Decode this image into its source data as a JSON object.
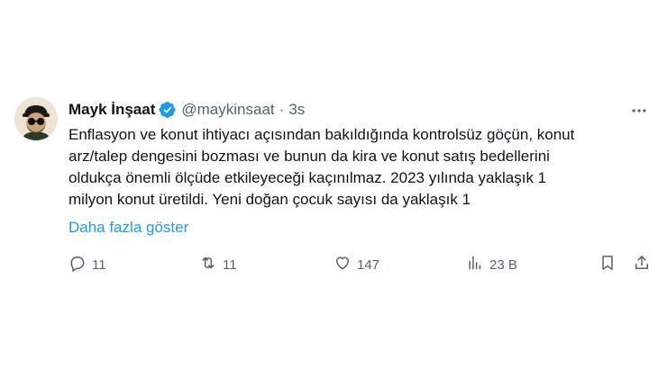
{
  "tweet": {
    "display_name": "Mayk İnşaat",
    "handle": "@maykinsaat",
    "separator": "·",
    "time": "3s",
    "text_lines": [
      "Enflasyon ve konut ihtiyacı açısından bakıldığında kontrolsüz göçün, konut",
      "arz/talep dengesini bozması ve bunun da kira ve konut satış bedellerini",
      "oldukça önemli ölçüde etkileyeceği kaçınılmaz. 2023 yılında yaklaşık 1",
      "milyon konut üretildi. Yeni doğan çocuk sayısı da yaklaşık 1"
    ],
    "show_more": "Daha fazla göster"
  },
  "actions": {
    "reply_count": "11",
    "retweet_count": "11",
    "like_count": "147",
    "views_count": "23 B"
  },
  "colors": {
    "accent": "#1d9bf0",
    "secondary_text": "#536471",
    "primary_text": "#0f1419"
  },
  "icons": [
    "verified-badge-icon",
    "more-icon",
    "reply-icon",
    "retweet-icon",
    "like-icon",
    "views-icon",
    "bookmark-icon",
    "share-icon"
  ]
}
